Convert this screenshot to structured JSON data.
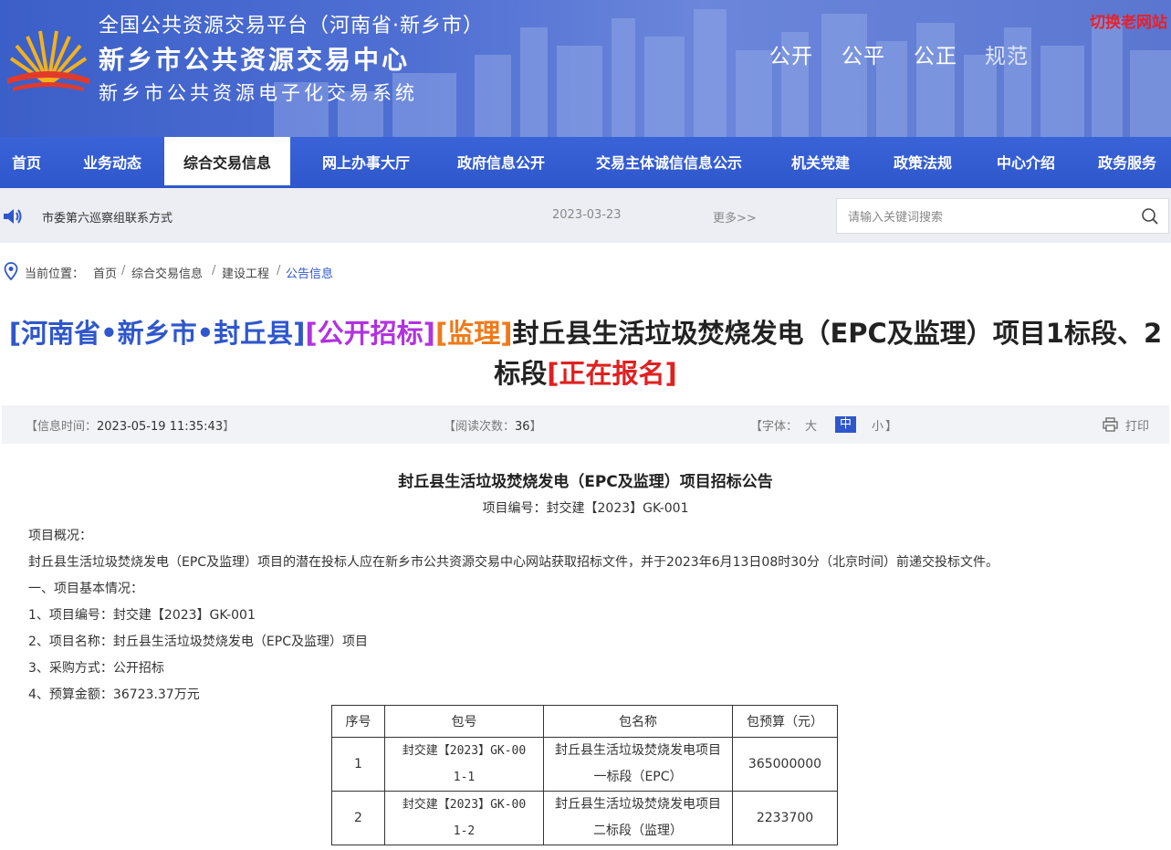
{
  "header": {
    "line1": "全国公共资源交易平台（河南省·新乡市）",
    "line2": "新乡市公共资源交易中心",
    "line3": "新乡市公共资源电子化交易系统",
    "slogans": [
      "公开",
      "公平",
      "公正",
      "规范"
    ],
    "old_site_link": "切换老网站",
    "brand_color": "#2f57cc"
  },
  "nav": {
    "items": [
      {
        "label": "首页"
      },
      {
        "label": "业务动态"
      },
      {
        "label": "综合交易信息",
        "active": true
      },
      {
        "label": "网上办事大厅"
      },
      {
        "label": "政府信息公开"
      },
      {
        "label": "交易主体诚信信息公示"
      },
      {
        "label": "机关党建"
      },
      {
        "label": "政策法规"
      },
      {
        "label": "中心介绍"
      },
      {
        "label": "政务服务"
      }
    ]
  },
  "notice": {
    "icon": "speaker-icon",
    "text": "市委第六巡察组联系方式",
    "date": "2023-03-23",
    "more": "更多>>"
  },
  "search": {
    "placeholder": "请输入关键词搜索",
    "value": "",
    "icon": "search-icon"
  },
  "breadcrumb": {
    "label": "当前位置：",
    "items": [
      "首页",
      "综合交易信息",
      "建设工程",
      "公告信息"
    ],
    "separator": "/"
  },
  "title": {
    "region": "[河南省•新乡市•封丘县]",
    "method": "[公开招标]",
    "category": "[监理]",
    "main_part1": "封丘县生活垃圾焚烧发电（EPC及监理）项目1标段、2",
    "main_part2": "标段",
    "status": "[正在报名]"
  },
  "info": {
    "time_label": "【信息时间：",
    "time_value": "2023-05-19 11:35:43",
    "time_end": "】",
    "views_label": "【阅读次数：",
    "views_value": "36",
    "views_end": "】",
    "font_label": "【字体：",
    "font_sizes": [
      "大",
      "中",
      "小"
    ],
    "font_active": "中",
    "font_end": "】",
    "print_label": "打印"
  },
  "article": {
    "title": "封丘县生活垃圾焚烧发电（EPC及监理）项目招标公告",
    "project_no_line": "项目编号：封交建【2023】GK-001",
    "paragraphs": [
      "项目概况：",
      "封丘县生活垃圾焚烧发电（EPC及监理）项目的潜在投标人应在新乡市公共资源交易中心网站获取招标文件，并于2023年6月13日08时30分（北京时间）前递交投标文件。",
      "一、项目基本情况：",
      "1、项目编号：封交建【2023】GK-001",
      "2、项目名称：封丘县生活垃圾焚烧发电（EPC及监理）项目",
      "3、采购方式：公开招标",
      "4、预算金额：36723.37万元"
    ],
    "table": {
      "headers": [
        "序号",
        "包号",
        "包名称",
        "包预算（元）"
      ],
      "rows": [
        {
          "no": "1",
          "pkg_a": "封交建【2023】GK-00",
          "pkg_b": "1-1",
          "name_a": "封丘县生活垃圾焚烧发电项目",
          "name_b": "一标段（EPC）",
          "budget": "365000000"
        },
        {
          "no": "2",
          "pkg_a": "封交建【2023】GK-00",
          "pkg_b": "1-2",
          "name_a": "封丘县生活垃圾焚烧发电项目",
          "name_b": "二标段（监理）",
          "budget": "2233700"
        }
      ]
    }
  }
}
